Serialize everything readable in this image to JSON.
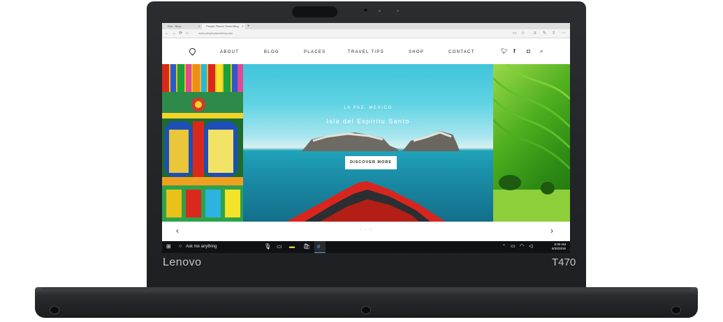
{
  "device": {
    "brand": "Lenovo",
    "model": "T470"
  },
  "browser": {
    "tabs": [
      {
        "label": "Edo - Blog",
        "active": false
      },
      {
        "label": "People Places Travel Blog",
        "active": true
      }
    ],
    "new_tab": "+",
    "address": "www.peopleplacesblog.com"
  },
  "site": {
    "nav": [
      "ABOUT",
      "BLOG",
      "PLACES",
      "TRAVEL TIPS",
      "SHOP",
      "CONTACT"
    ],
    "hero": {
      "kicker": "LA PAZ, MEXICO",
      "title": "Isla del Espiritu Santo",
      "cta": "DISCOVER MORE"
    },
    "slider": {
      "prev": "‹",
      "next": "›",
      "dots": "• • •"
    }
  },
  "taskbar": {
    "search_placeholder": "Ask me anything",
    "time": "6:30 AM",
    "date": "6/30/2016"
  }
}
